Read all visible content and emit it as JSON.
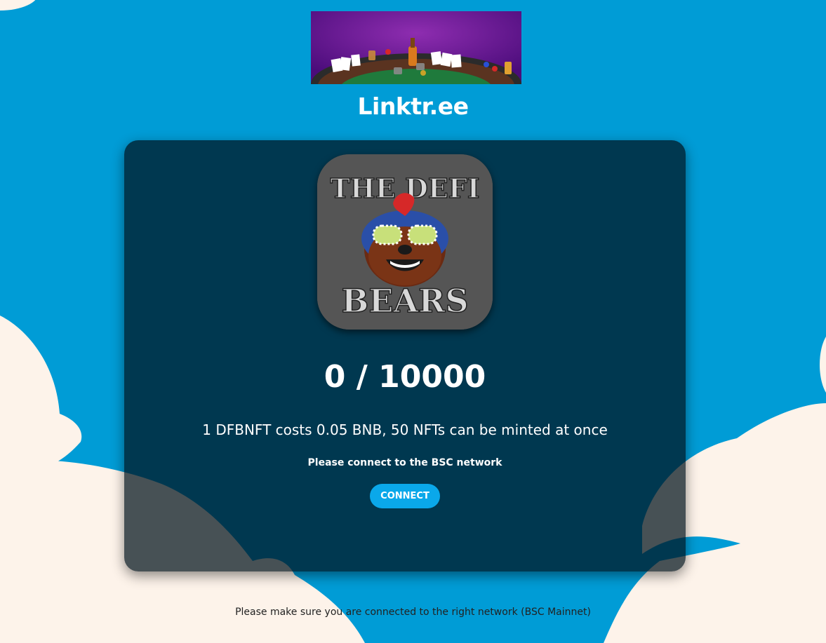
{
  "header": {
    "brand_link": "Linktr.ee"
  },
  "logo": {
    "line1": "THE DEFI",
    "line2": "BEARS"
  },
  "mint": {
    "count": "0 / 10000",
    "cost_text": "1 DFBNFT costs 0.05 BNB, 50 NFTs can be minted at once",
    "network_prompt": "Please connect to the BSC network",
    "connect_label": "CONNECT"
  },
  "footer": {
    "note": "Please make sure you are connected to the right network (BSC Mainnet)"
  },
  "colors": {
    "sky": "#009cd6",
    "cloud": "#fdf3ea",
    "card": "#00121c",
    "accent": "#0aa8ea"
  }
}
